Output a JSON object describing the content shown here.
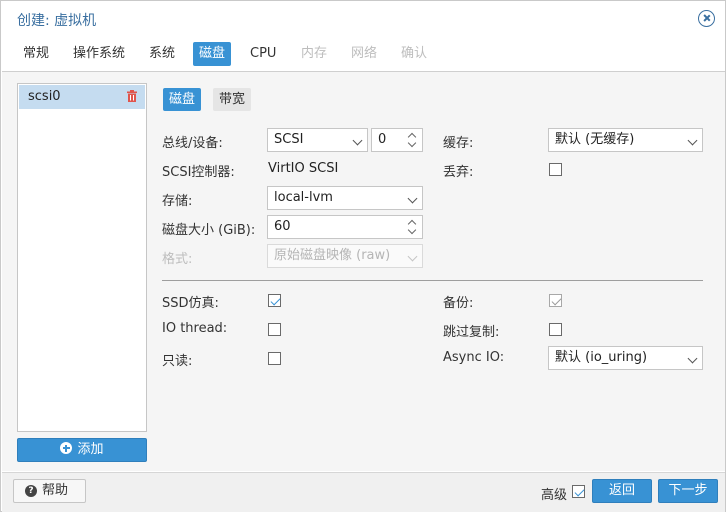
{
  "title": "创建: 虚拟机",
  "tabs": [
    "常规",
    "操作系统",
    "系统",
    "磁盘",
    "CPU",
    "内存",
    "网络",
    "确认"
  ],
  "disks": [
    {
      "label": "scsi0"
    }
  ],
  "add_label": "添加",
  "subtabs": {
    "disk": "磁盘",
    "bandwidth": "带宽"
  },
  "form": {
    "bus_device_label": "总线/设备:",
    "bus_value": "SCSI",
    "device_index": "0",
    "scsi_controller_label": "SCSI控制器:",
    "scsi_controller_value": "VirtIO SCSI",
    "storage_label": "存储:",
    "storage_value": "local-lvm",
    "disk_size_label": "磁盘大小 (GiB):",
    "disk_size_value": "60",
    "format_label": "格式:",
    "format_value": "原始磁盘映像 (raw)",
    "cache_label": "缓存:",
    "cache_value": "默认 (无缓存)",
    "discard_label": "丢弃:",
    "ssd_label": "SSD仿真:",
    "iothread_label": "IO thread:",
    "readonly_label": "只读:",
    "backup_label": "备份:",
    "skip_replication_label": "跳过复制:",
    "async_io_label": "Async IO:",
    "async_io_value": "默认 (io_uring)"
  },
  "footer": {
    "help_label": "帮助",
    "advanced_label": "高级",
    "back_label": "返回",
    "next_label": "下一步"
  },
  "colors": {
    "accent": "#3892d4",
    "title": "#3a6fa0",
    "delete": "#e0554d"
  }
}
